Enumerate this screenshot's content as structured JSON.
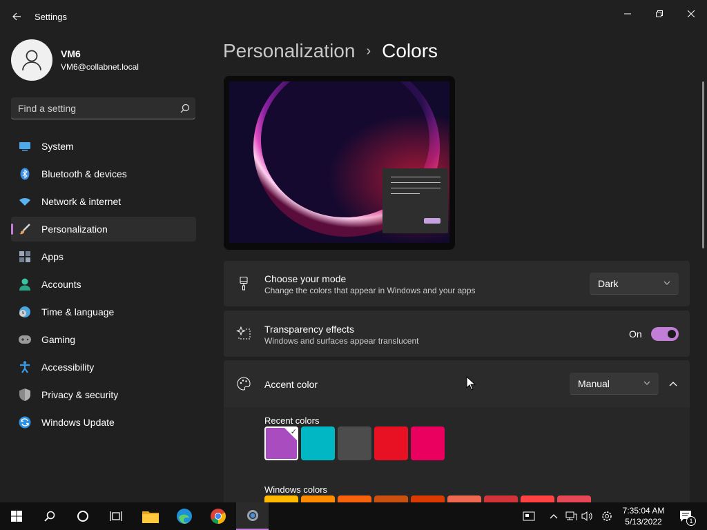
{
  "window": {
    "title": "Settings"
  },
  "profile": {
    "name": "VM6",
    "email": "VM6@collabnet.local"
  },
  "search": {
    "placeholder": "Find a setting"
  },
  "sidebar": {
    "items": [
      {
        "label": "System",
        "icon": "monitor-icon",
        "color": "#4fa9e8"
      },
      {
        "label": "Bluetooth & devices",
        "icon": "bluetooth-icon",
        "color": "#3a8ee6"
      },
      {
        "label": "Network & internet",
        "icon": "wifi-icon",
        "color": "#58b4f0"
      },
      {
        "label": "Personalization",
        "icon": "brush-icon",
        "color": "#e8a060",
        "active": true
      },
      {
        "label": "Apps",
        "icon": "apps-icon",
        "color": "#9aa8b8"
      },
      {
        "label": "Accounts",
        "icon": "person-icon",
        "color": "#3cc3a0"
      },
      {
        "label": "Time & language",
        "icon": "clock-globe-icon",
        "color": "#4aa6e0"
      },
      {
        "label": "Gaming",
        "icon": "gamepad-icon",
        "color": "#9a9a9a"
      },
      {
        "label": "Accessibility",
        "icon": "accessibility-icon",
        "color": "#3a9ae6"
      },
      {
        "label": "Privacy & security",
        "icon": "shield-icon",
        "color": "#8a8a8a"
      },
      {
        "label": "Windows Update",
        "icon": "update-icon",
        "color": "#2f8fe0"
      }
    ]
  },
  "breadcrumb": {
    "parent": "Personalization",
    "separator": "›",
    "current": "Colors"
  },
  "mode_card": {
    "title": "Choose your mode",
    "description": "Change the colors that appear in Windows and your apps",
    "value": "Dark"
  },
  "transparency_card": {
    "title": "Transparency effects",
    "description": "Windows and surfaces appear translucent",
    "state_label": "On",
    "enabled": true
  },
  "accent_card": {
    "title": "Accent color",
    "value": "Manual",
    "expanded": true,
    "recent_label": "Recent colors",
    "windows_label": "Windows colors",
    "recent_colors": [
      "#a84cc0",
      "#00b7c3",
      "#4c4c4c",
      "#e81123",
      "#ea005e"
    ],
    "selected_recent_index": 0,
    "windows_colors": [
      "#ffb900",
      "#ff8c00",
      "#f7630c",
      "#ca5010",
      "#da3b01",
      "#ef6950",
      "#d13438",
      "#ff4343",
      "#e74856"
    ]
  },
  "taskbar": {
    "time": "7:35:04 AM",
    "date": "5/13/2022",
    "notification_count": "1",
    "accent": "#c27dd6"
  }
}
